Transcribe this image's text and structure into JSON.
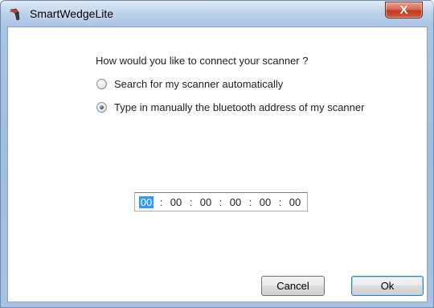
{
  "window": {
    "title": "SmartWedgeLite",
    "close_label": "X"
  },
  "dialog": {
    "question": "How would you like to connect your scanner ?",
    "options": [
      {
        "label": "Search for my scanner automatically",
        "checked": false
      },
      {
        "label": "Type in manually the bluetooth address of my scanner",
        "checked": true
      }
    ],
    "address": {
      "octets": [
        "00",
        "00",
        "00",
        "00",
        "00",
        "00"
      ],
      "separator": ":"
    }
  },
  "buttons": {
    "cancel_label": "Cancel",
    "ok_label": "Ok"
  },
  "colors": {
    "selection": "#3399ff",
    "close_button": "#c0391f"
  },
  "icons": {
    "app": "scanner-icon",
    "close": "close-icon"
  }
}
